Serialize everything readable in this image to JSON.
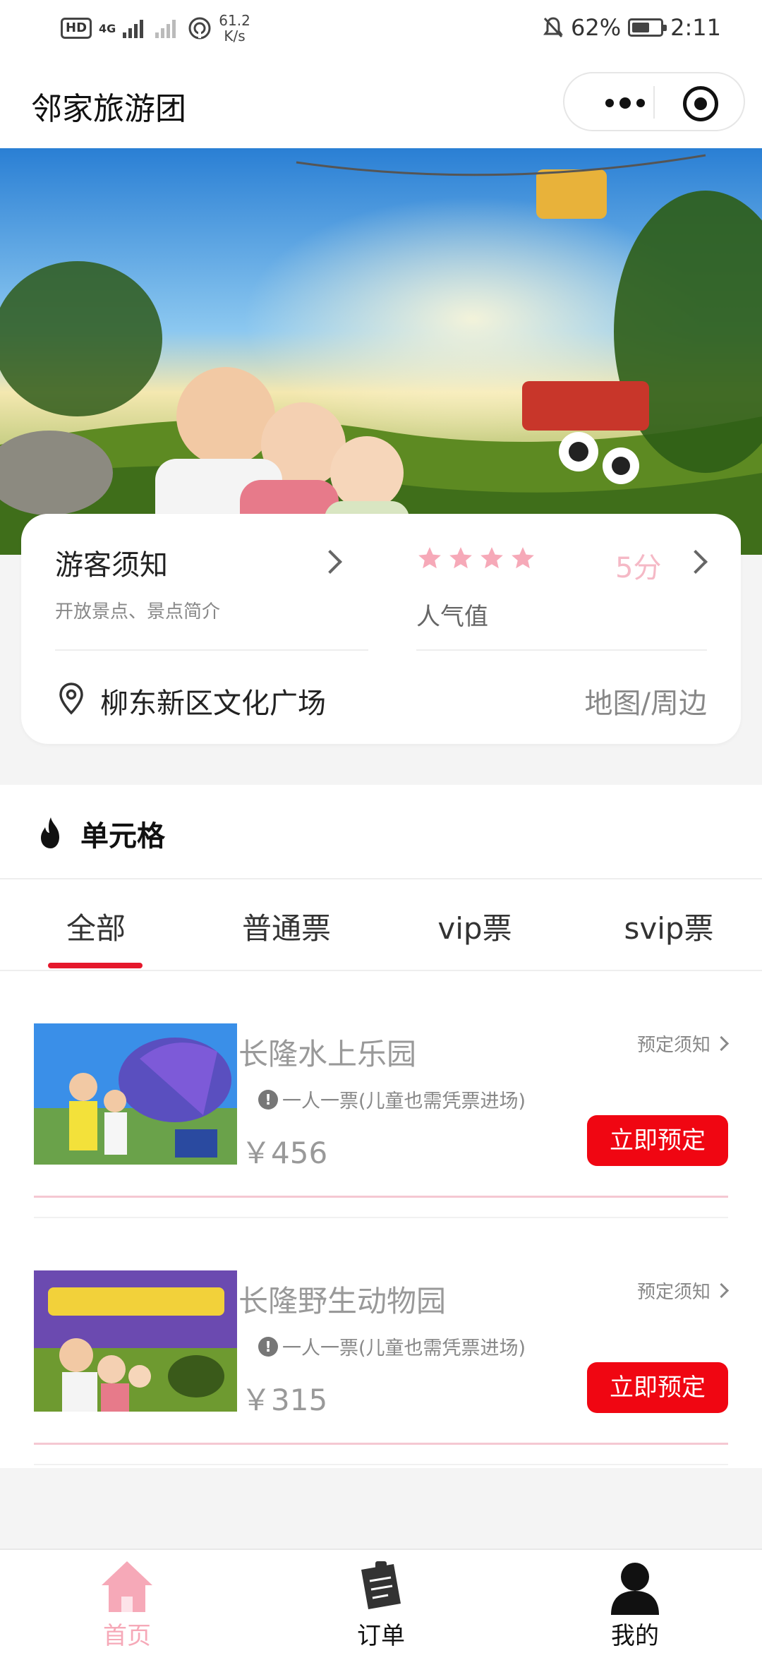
{
  "status_bar": {
    "network_badge": "HD",
    "signal_label": "4G",
    "speed_value": "61.2",
    "speed_unit": "K/s",
    "battery": "62%",
    "battery_level": 0.62,
    "time": "2:11"
  },
  "nav": {
    "title": "邻家旅游团",
    "more_icon": "more-dots-icon",
    "close_icon": "target-icon"
  },
  "banner": {
    "alt": "theme-park-family-banner"
  },
  "info_card": {
    "guide_title": "游客须知",
    "guide_sub": "开放景点、景点简介",
    "rating_stars": 4,
    "rating_score": "5分",
    "popularity_label": "人气值",
    "location": "柳东新区文化广场",
    "map_link": "地图/周边"
  },
  "section": {
    "title": "单元格",
    "tabs": [
      "全部",
      "普通票",
      "vip票",
      "svip票"
    ],
    "active_tab": 0
  },
  "tickets": [
    {
      "name": "长隆水上乐园",
      "notice": "预定须知",
      "rule": "一人一票(儿童也需凭票进场)",
      "price": "￥456",
      "button": "立即预定"
    },
    {
      "name": "长隆野生动物园",
      "notice": "预定须知",
      "rule": "一人一票(儿童也需凭票进场)",
      "price": "￥315",
      "button": "立即预定"
    }
  ],
  "tab_bar": {
    "items": [
      {
        "label": "首页",
        "icon": "home-icon",
        "active": true
      },
      {
        "label": "订单",
        "icon": "order-icon",
        "active": false
      },
      {
        "label": "我的",
        "icon": "user-icon",
        "active": false
      }
    ],
    "active_color": "#f6a9b8"
  }
}
